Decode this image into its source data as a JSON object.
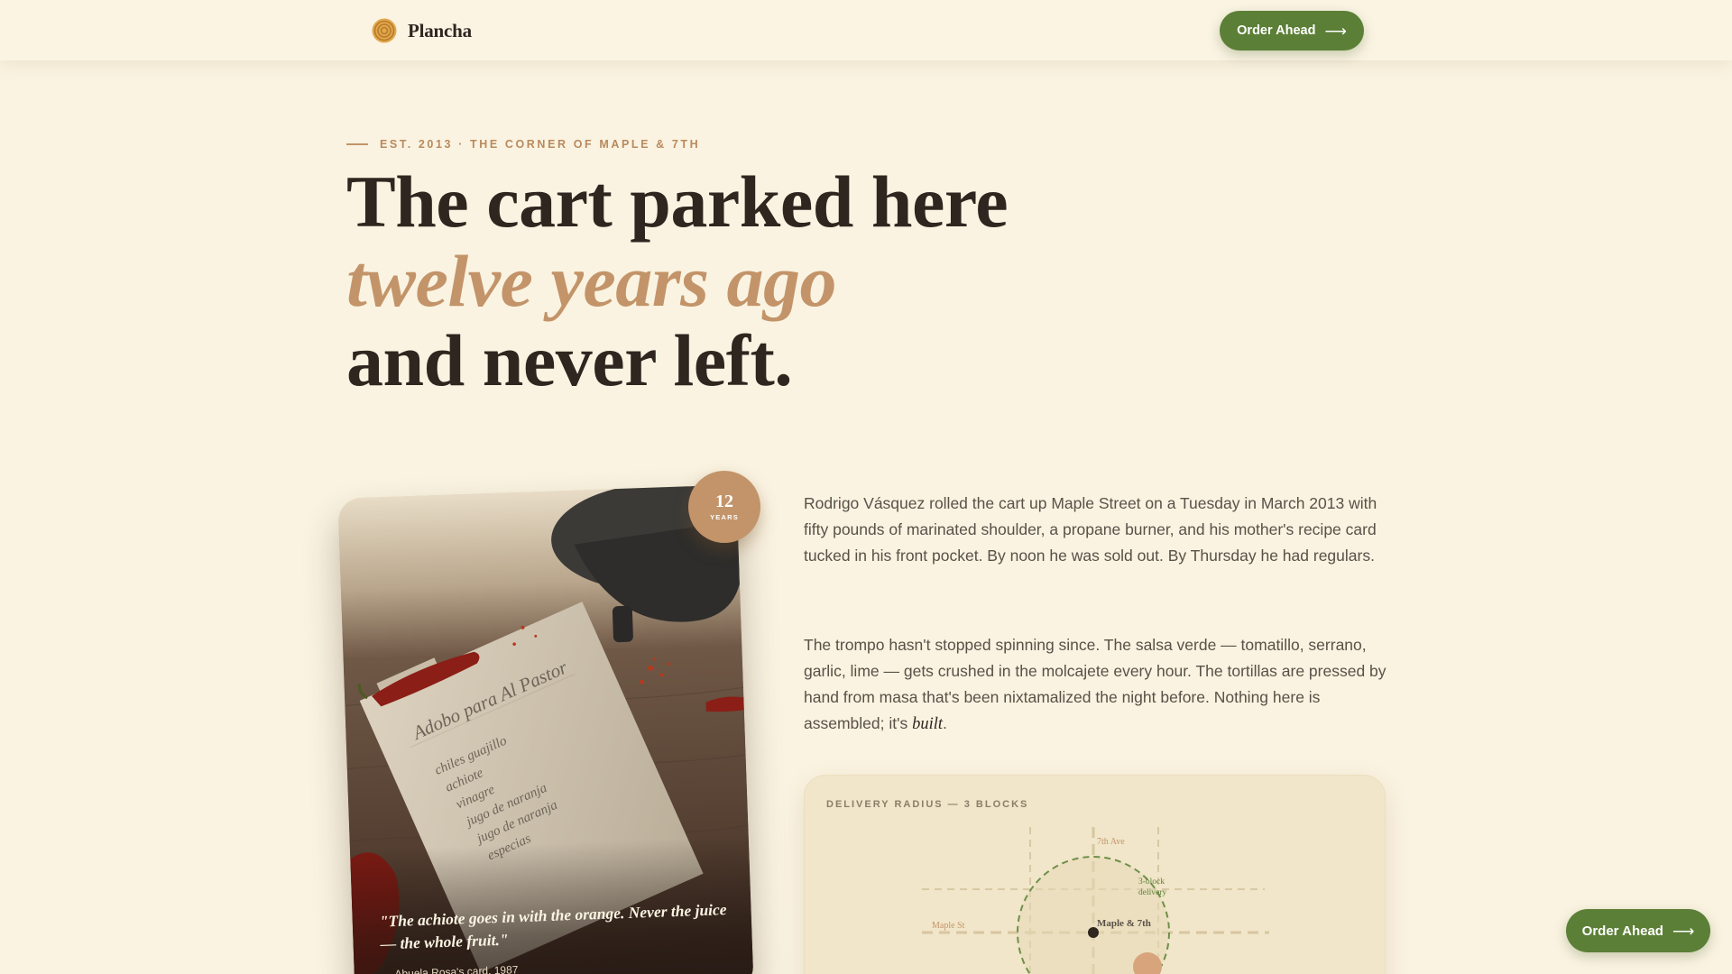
{
  "header": {
    "brand_name": "Plancha",
    "order_label": "Order Ahead"
  },
  "hero": {
    "eyebrow": "EST. 2013 · THE CORNER OF MAPLE & 7TH",
    "headline_line1": "The cart parked here",
    "headline_line2": "twelve years ago",
    "headline_line3": "and never left."
  },
  "photo": {
    "recipe_title": "Adobo para Al Pastor",
    "recipe_items": [
      "chiles guajillo",
      "achiote",
      "vinagre",
      "jugo de naranja",
      "jugo de naranja",
      "especias"
    ],
    "quote": "\"The achiote goes in with the orange. Never the juice — the whole fruit.\"",
    "credit": "— Abuela Rosa's card, 1987",
    "badge_number": "12",
    "badge_label": "YEARS"
  },
  "story": {
    "p1": "Rodrigo Vásquez rolled the cart up Maple Street on a Tuesday in March 2013 with fifty pounds of marinated shoulder, a propane burner, and his mother's recipe card tucked in his front pocket. By noon he was sold out. By Thursday he had regulars.",
    "p2_before": "The trompo hasn't stopped spinning since. The salsa verde — tomatillo, serrano, garlic, lime — gets crushed in the molcajete every hour. The tortillas are pressed by hand from masa that's been nixtamalized the night before. Nothing here is assembled; it's ",
    "p2_em": "built",
    "p2_after": "."
  },
  "map": {
    "title": "DELIVERY RADIUS — 3 BLOCKS",
    "avenue_label": "7th Ave",
    "street_label": "Maple St",
    "center_label": "Maple & 7th",
    "radius_label_line1": "3-block",
    "radius_label_line2": "delivery"
  },
  "floating": {
    "order_label": "Order Ahead"
  },
  "colors": {
    "background": "#faf3e1",
    "accent_tan": "#c39469",
    "brand_green": "#5b7f36",
    "ink": "#2f2620"
  }
}
